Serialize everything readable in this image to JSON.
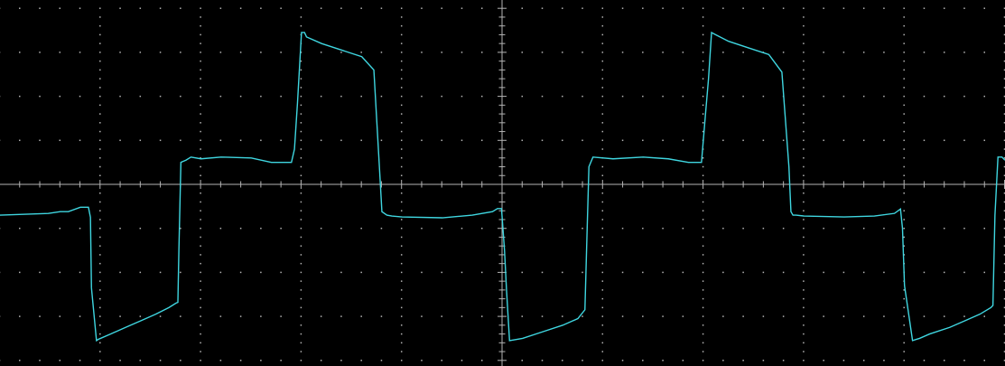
{
  "display": {
    "background_color": "#000000",
    "graticule_color": "#b4b4b4",
    "trace_color": "#3fd6e0"
  },
  "chart_data": {
    "type": "line",
    "title": "",
    "xlabel": "",
    "ylabel": "",
    "grid": true,
    "grid_style": "dotted graticule with ticked center axes",
    "x_divisions": 10,
    "y_divisions": 8,
    "minor_ticks_per_division": 5,
    "xlim": [
      0,
      10
    ],
    "ylim": [
      -4,
      4
    ],
    "series": [
      {
        "x": [
          0.0,
          0.48,
          0.6,
          0.68,
          0.8,
          0.88,
          0.9,
          0.91,
          0.96,
          0.98,
          1.0,
          1.1,
          1.25,
          1.4,
          1.55,
          1.68,
          1.75,
          1.77,
          1.78,
          1.8,
          1.85,
          1.9,
          2.0,
          2.2,
          2.5,
          2.7,
          2.9,
          2.93,
          2.96,
          3.0,
          3.03,
          3.05,
          3.2,
          3.4,
          3.6,
          3.72,
          3.78,
          3.8,
          3.85,
          3.9,
          4.0,
          4.4,
          4.7,
          4.9,
          4.95,
          4.99,
          5.02,
          5.04,
          5.07,
          5.2,
          5.4,
          5.6,
          5.75,
          5.82,
          5.84,
          5.86,
          5.9,
          6.1,
          6.4,
          6.65,
          6.85,
          6.98,
          7.02,
          7.05,
          7.08,
          7.12,
          7.25,
          7.45,
          7.65,
          7.78,
          7.85,
          7.87,
          7.89,
          7.92,
          8.0,
          8.4,
          8.7,
          8.9,
          8.96,
          8.98,
          9.0,
          9.08,
          9.12,
          9.15,
          9.25,
          9.45,
          9.6,
          9.75,
          9.86,
          9.88,
          9.9,
          9.93,
          9.97,
          10.0
        ],
        "y": [
          -0.7,
          -0.66,
          -0.62,
          -0.62,
          -0.52,
          -0.52,
          -0.75,
          -2.35,
          -3.55,
          -3.52,
          -3.5,
          -3.4,
          -3.25,
          -3.1,
          -2.95,
          -2.8,
          -2.7,
          -2.68,
          -1.5,
          0.5,
          0.55,
          0.62,
          0.58,
          0.62,
          0.6,
          0.5,
          0.5,
          0.8,
          1.85,
          3.45,
          3.45,
          3.35,
          3.2,
          3.05,
          2.9,
          2.6,
          0.2,
          -0.62,
          -0.7,
          -0.72,
          -0.74,
          -0.76,
          -0.7,
          -0.62,
          -0.55,
          -0.55,
          -1.5,
          -2.4,
          -3.55,
          -3.5,
          -3.35,
          -3.2,
          -3.05,
          -2.85,
          -1.2,
          0.4,
          0.62,
          0.58,
          0.62,
          0.58,
          0.5,
          0.5,
          1.6,
          2.4,
          3.45,
          3.4,
          3.25,
          3.1,
          2.95,
          2.55,
          0.4,
          -0.62,
          -0.7,
          -0.7,
          -0.72,
          -0.74,
          -0.72,
          -0.66,
          -0.56,
          -1.0,
          -2.3,
          -3.55,
          -3.52,
          -3.5,
          -3.4,
          -3.25,
          -3.1,
          -2.95,
          -2.8,
          -2.75,
          -0.7,
          0.62,
          0.62,
          0.55
        ]
      }
    ]
  }
}
